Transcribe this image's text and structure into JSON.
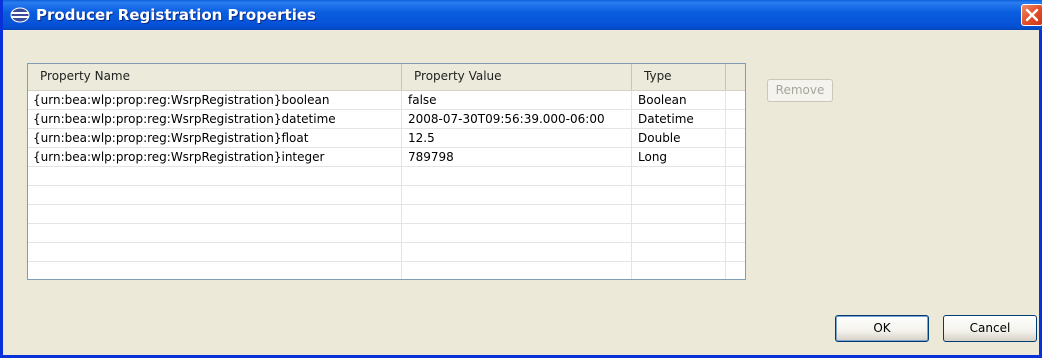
{
  "window": {
    "title": "Producer Registration Properties"
  },
  "table": {
    "columns": [
      "Property Name",
      "Property Value",
      "Type"
    ],
    "rows": [
      [
        "{urn:bea:wlp:prop:reg:WsrpRegistration}boolean",
        "false",
        "Boolean"
      ],
      [
        "{urn:bea:wlp:prop:reg:WsrpRegistration}datetime",
        "2008-07-30T09:56:39.000-06:00",
        "Datetime"
      ],
      [
        "{urn:bea:wlp:prop:reg:WsrpRegistration}float",
        "12.5",
        "Double"
      ],
      [
        "{urn:bea:wlp:prop:reg:WsrpRegistration}integer",
        "789798",
        "Long"
      ]
    ]
  },
  "buttons": {
    "remove": "Remove",
    "ok": "OK",
    "cancel": "Cancel"
  },
  "colors": {
    "titlebar": "#0a5fd8",
    "window_frame": "#0831d9",
    "dialog_bg": "#ece9d8",
    "close_button": "#e2512a"
  }
}
